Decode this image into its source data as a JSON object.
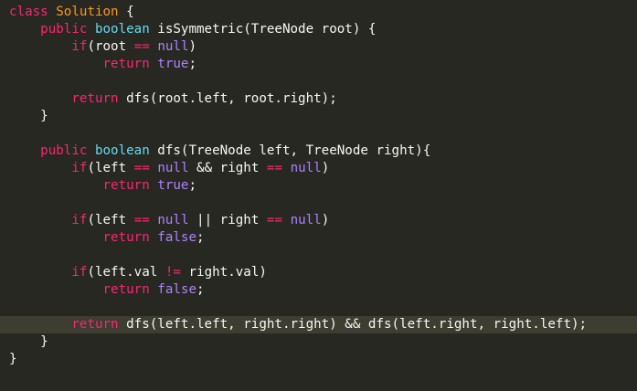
{
  "editor": {
    "language": "java",
    "colors": {
      "background": "#272822",
      "current_line": "#3e3d32",
      "keyword": "#f92672",
      "type": "#66d9ef",
      "class_name": "#fd971f",
      "constant": "#ae81ff",
      "text": "#f8f8f2"
    },
    "lines": [
      {
        "tokens": [
          {
            "t": "class ",
            "c": "kw"
          },
          {
            "t": "Solution",
            "c": "cls"
          },
          {
            "t": " {",
            "c": "plain"
          }
        ]
      },
      {
        "tokens": [
          {
            "t": "    ",
            "c": "plain"
          },
          {
            "t": "public ",
            "c": "kw"
          },
          {
            "t": "boolean",
            "c": "type"
          },
          {
            "t": " isSymmetric(TreeNode root) {",
            "c": "plain"
          }
        ]
      },
      {
        "tokens": [
          {
            "t": "        ",
            "c": "plain"
          },
          {
            "t": "if",
            "c": "kw"
          },
          {
            "t": "(root ",
            "c": "plain"
          },
          {
            "t": "==",
            "c": "kw"
          },
          {
            "t": " ",
            "c": "plain"
          },
          {
            "t": "null",
            "c": "const"
          },
          {
            "t": ")",
            "c": "plain"
          }
        ]
      },
      {
        "tokens": [
          {
            "t": "            ",
            "c": "plain"
          },
          {
            "t": "return ",
            "c": "kw"
          },
          {
            "t": "true",
            "c": "const"
          },
          {
            "t": ";",
            "c": "plain"
          }
        ]
      },
      {
        "tokens": []
      },
      {
        "tokens": [
          {
            "t": "        ",
            "c": "plain"
          },
          {
            "t": "return ",
            "c": "kw"
          },
          {
            "t": "dfs(root.left, root.right);",
            "c": "plain"
          }
        ]
      },
      {
        "tokens": [
          {
            "t": "    }",
            "c": "plain"
          }
        ]
      },
      {
        "tokens": []
      },
      {
        "tokens": [
          {
            "t": "    ",
            "c": "plain"
          },
          {
            "t": "public ",
            "c": "kw"
          },
          {
            "t": "boolean",
            "c": "type"
          },
          {
            "t": " dfs(TreeNode left, TreeNode right){",
            "c": "plain"
          }
        ]
      },
      {
        "tokens": [
          {
            "t": "        ",
            "c": "plain"
          },
          {
            "t": "if",
            "c": "kw"
          },
          {
            "t": "(left ",
            "c": "plain"
          },
          {
            "t": "==",
            "c": "kw"
          },
          {
            "t": " ",
            "c": "plain"
          },
          {
            "t": "null",
            "c": "const"
          },
          {
            "t": " && right ",
            "c": "plain"
          },
          {
            "t": "==",
            "c": "kw"
          },
          {
            "t": " ",
            "c": "plain"
          },
          {
            "t": "null",
            "c": "const"
          },
          {
            "t": ")",
            "c": "plain"
          }
        ]
      },
      {
        "tokens": [
          {
            "t": "            ",
            "c": "plain"
          },
          {
            "t": "return ",
            "c": "kw"
          },
          {
            "t": "true",
            "c": "const"
          },
          {
            "t": ";",
            "c": "plain"
          }
        ]
      },
      {
        "tokens": []
      },
      {
        "tokens": [
          {
            "t": "        ",
            "c": "plain"
          },
          {
            "t": "if",
            "c": "kw"
          },
          {
            "t": "(left ",
            "c": "plain"
          },
          {
            "t": "==",
            "c": "kw"
          },
          {
            "t": " ",
            "c": "plain"
          },
          {
            "t": "null",
            "c": "const"
          },
          {
            "t": " || right ",
            "c": "plain"
          },
          {
            "t": "==",
            "c": "kw"
          },
          {
            "t": " ",
            "c": "plain"
          },
          {
            "t": "null",
            "c": "const"
          },
          {
            "t": ")",
            "c": "plain"
          }
        ]
      },
      {
        "tokens": [
          {
            "t": "            ",
            "c": "plain"
          },
          {
            "t": "return ",
            "c": "kw"
          },
          {
            "t": "false",
            "c": "const"
          },
          {
            "t": ";",
            "c": "plain"
          }
        ]
      },
      {
        "tokens": []
      },
      {
        "tokens": [
          {
            "t": "        ",
            "c": "plain"
          },
          {
            "t": "if",
            "c": "kw"
          },
          {
            "t": "(left.val ",
            "c": "plain"
          },
          {
            "t": "!=",
            "c": "kw"
          },
          {
            "t": " right.val)",
            "c": "plain"
          }
        ]
      },
      {
        "tokens": [
          {
            "t": "            ",
            "c": "plain"
          },
          {
            "t": "return ",
            "c": "kw"
          },
          {
            "t": "false",
            "c": "const"
          },
          {
            "t": ";",
            "c": "plain"
          }
        ]
      },
      {
        "tokens": []
      },
      {
        "current": true,
        "tokens": [
          {
            "t": "        ",
            "c": "plain"
          },
          {
            "t": "return ",
            "c": "kw"
          },
          {
            "t": "dfs(left.left, right.right) && dfs(left.right, right.left);",
            "c": "plain"
          }
        ]
      },
      {
        "tokens": [
          {
            "t": "    }",
            "c": "plain"
          }
        ]
      },
      {
        "tokens": [
          {
            "t": "}",
            "c": "plain"
          }
        ]
      }
    ]
  }
}
